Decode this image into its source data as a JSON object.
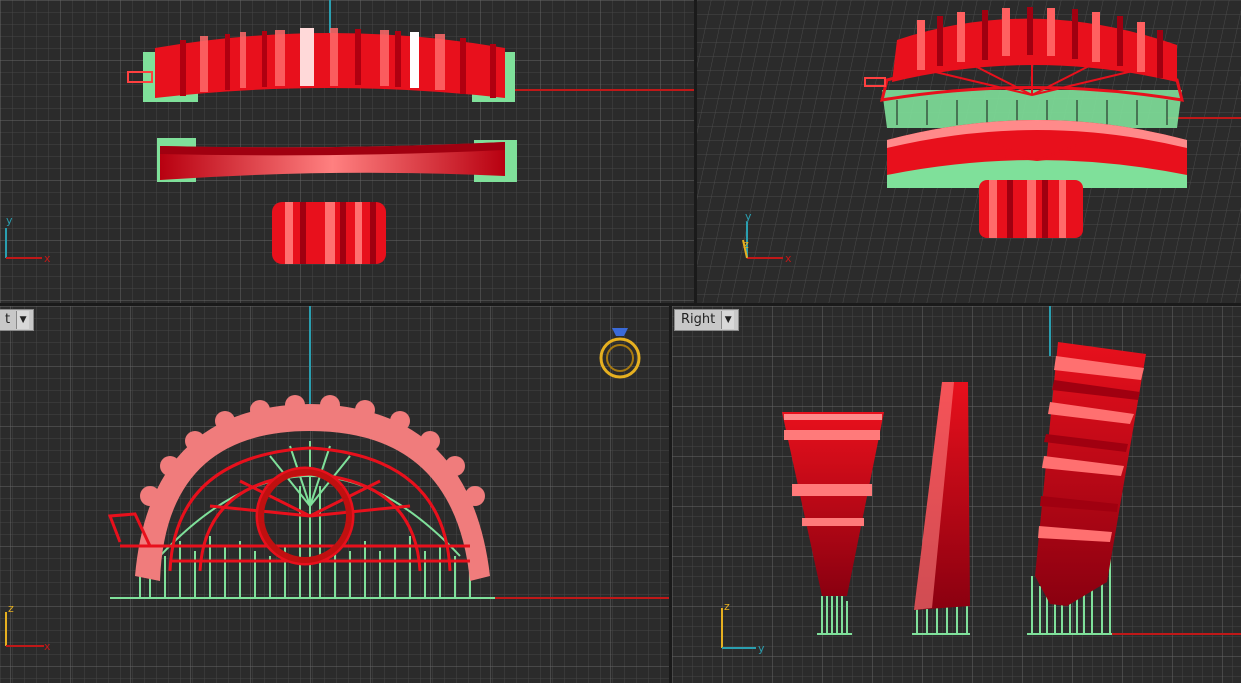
{
  "viewports": {
    "front": {
      "label": "t"
    },
    "right": {
      "label": "Right"
    }
  },
  "axes": {
    "top": {
      "x": "x",
      "y": "y"
    },
    "perspective": {
      "x": "x",
      "y": "y",
      "z": "z"
    },
    "front": {
      "x": "x",
      "z": "z"
    },
    "right": {
      "y": "y",
      "z": "z"
    }
  },
  "icons": {
    "dropdown": "chevron-down-icon",
    "ring_gizmo": "ring-gem-icon"
  },
  "colors": {
    "viewport_bg": "#2b2b2b",
    "grid_minor": "#4a4a4a",
    "grid_major": "#6a6a6a",
    "model_red": "#e8101c",
    "support_green": "#7fe09a",
    "axis_red": "#c01818",
    "axis_cyan": "#2a9fb0",
    "gizmo_gold": "#e6b020"
  }
}
